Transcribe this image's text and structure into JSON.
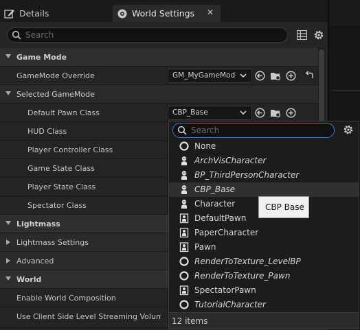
{
  "tabs": [
    {
      "label": "Details",
      "icon": "pencil-icon"
    },
    {
      "label": "World Settings",
      "icon": "world-settings-icon",
      "close": "✕"
    }
  ],
  "search": {
    "placeholder": "Search"
  },
  "rows": [
    {
      "kind": "cat",
      "label": "Game Mode",
      "expanded": true
    },
    {
      "kind": "prop",
      "label": "GameMode Override",
      "value": "GM_MyGameMode"
    },
    {
      "kind": "sub",
      "label": "Selected GameMode",
      "expanded": true
    },
    {
      "kind": "prop",
      "label": "Default Pawn Class",
      "value": "CBP_Base"
    },
    {
      "kind": "prop",
      "label": "HUD Class"
    },
    {
      "kind": "prop",
      "label": "Player Controller Class"
    },
    {
      "kind": "prop",
      "label": "Game State Class"
    },
    {
      "kind": "prop",
      "label": "Player State Class"
    },
    {
      "kind": "prop",
      "label": "Spectator Class"
    },
    {
      "kind": "cat",
      "label": "Lightmass",
      "expanded": true
    },
    {
      "kind": "sub",
      "label": "Lightmass Settings",
      "expanded": false
    },
    {
      "kind": "sub",
      "label": "Advanced",
      "expanded": false
    },
    {
      "kind": "cat",
      "label": "World",
      "expanded": true
    },
    {
      "kind": "prop",
      "label": "Enable World Composition"
    },
    {
      "kind": "prop",
      "label": "Use Client Side Level Streaming Volumes"
    }
  ],
  "dropdown": {
    "search_placeholder": "Search",
    "items": [
      {
        "label": "None",
        "icon": "circle-icon",
        "italic": false
      },
      {
        "label": "ArchVisCharacter",
        "icon": "character-icon",
        "italic": true
      },
      {
        "label": "BP_ThirdPersonCharacter",
        "icon": "character-icon",
        "italic": true
      },
      {
        "label": "CBP_Base",
        "icon": "character-icon",
        "italic": true,
        "highlighted": true
      },
      {
        "label": "Character",
        "icon": "character-icon",
        "italic": false
      },
      {
        "label": "DefaultPawn",
        "icon": "pawn-icon",
        "italic": false
      },
      {
        "label": "PaperCharacter",
        "icon": "pawn-icon",
        "italic": false
      },
      {
        "label": "Pawn",
        "icon": "pawn-icon",
        "italic": false
      },
      {
        "label": "RenderToTexture_LevelBP",
        "icon": "circle-icon",
        "italic": true
      },
      {
        "label": "RenderToTexture_Pawn",
        "icon": "circle-icon",
        "italic": true
      },
      {
        "label": "SpectatorPawn",
        "icon": "pawn-icon",
        "italic": false
      },
      {
        "label": "TutorialCharacter",
        "icon": "circle-icon",
        "italic": true
      }
    ],
    "footer": "12 items"
  },
  "tooltip": "CBP Base",
  "colors": {
    "accent": "#3a7bd5",
    "panel": "#242424",
    "category": "#2f2f2f"
  }
}
